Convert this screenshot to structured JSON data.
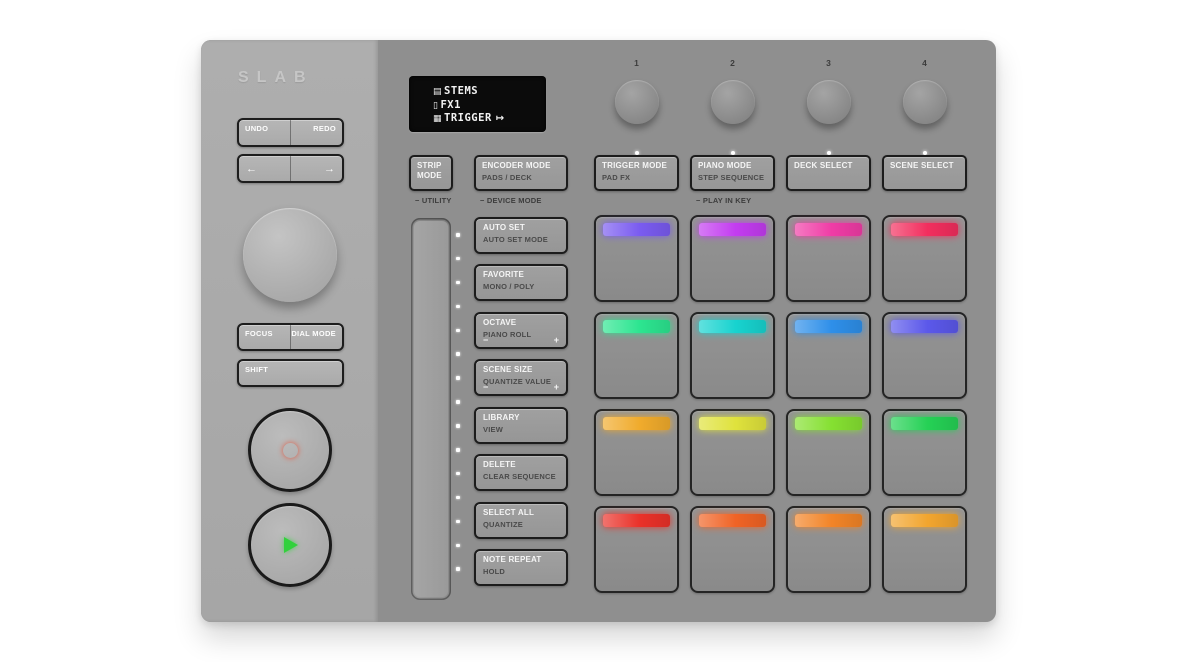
{
  "device": {
    "brand": "SLAB",
    "colors": {
      "left_panel": "#a9a9a9",
      "right_panel": "#8f8f8f",
      "button_outline": "#1c1c1c",
      "display_bg": "#0b0b0b",
      "display_text": "#f2f2f2",
      "record_dot": "#ee4123",
      "play_triangle": "#32d13c",
      "led": "#ffffff"
    }
  },
  "left_controls": {
    "undo": "UNDO",
    "redo": "REDO",
    "arrow_left": "←",
    "arrow_right": "→",
    "focus": "FOCUS",
    "dial_mode": "DIAL MODE",
    "shift": "SHIFT"
  },
  "display": {
    "lines": [
      {
        "icon": "deck-icon",
        "glyph": "▤",
        "text": "STEMS",
        "suffix": ""
      },
      {
        "icon": "strip-icon",
        "glyph": "▯",
        "text": "FX1",
        "suffix": ""
      },
      {
        "icon": "grid-icon",
        "glyph": "▦",
        "text": "TRIGGER",
        "suffix": "↦"
      }
    ]
  },
  "knobs": {
    "numbers": [
      "1",
      "2",
      "3",
      "4"
    ]
  },
  "mode_buttons": [
    {
      "title": "STRIP MODE",
      "subtitle": "",
      "shift_label": "− UTILITY"
    },
    {
      "title": "ENCODER MODE",
      "subtitle": "PADS / DECK",
      "shift_label": "− DEVICE MODE"
    },
    {
      "title": "TRIGGER MODE",
      "subtitle": "PAD FX",
      "shift_label": ""
    },
    {
      "title": "PIANO MODE",
      "subtitle": "STEP SEQUENCE",
      "shift_label": "− PLAY IN KEY"
    },
    {
      "title": "DECK SELECT",
      "subtitle": "",
      "shift_label": ""
    },
    {
      "title": "SCENE SELECT",
      "subtitle": "",
      "shift_label": ""
    }
  ],
  "function_buttons": [
    {
      "title": "AUTO SET",
      "subtitle": "AUTO SET MODE"
    },
    {
      "title": "FAVORITE",
      "subtitle": "MONO / POLY"
    },
    {
      "title": "OCTAVE",
      "subtitle": "PIANO ROLL"
    },
    {
      "title": "SCENE SIZE",
      "subtitle": "QUANTIZE VALUE"
    },
    {
      "title": "LIBRARY",
      "subtitle": "VIEW"
    },
    {
      "title": "DELETE",
      "subtitle": "CLEAR SEQUENCE"
    },
    {
      "title": "SELECT ALL",
      "subtitle": "QUANTIZE"
    },
    {
      "title": "NOTE REPEAT",
      "subtitle": "HOLD"
    }
  ],
  "glyphs": {
    "minus": "−",
    "plus": "+"
  },
  "touch_strip": {
    "led_count": 15
  },
  "pads": {
    "colors": [
      "#7a5bf0",
      "#c33cf0",
      "#f03ca6",
      "#f22e5e",
      "#2ce590",
      "#17d3cf",
      "#2e8fe9",
      "#5b58ea",
      "#f0ab2c",
      "#dfe23c",
      "#85e031",
      "#25d155",
      "#ea3129",
      "#f06325",
      "#f28427",
      "#f2a52e"
    ]
  }
}
